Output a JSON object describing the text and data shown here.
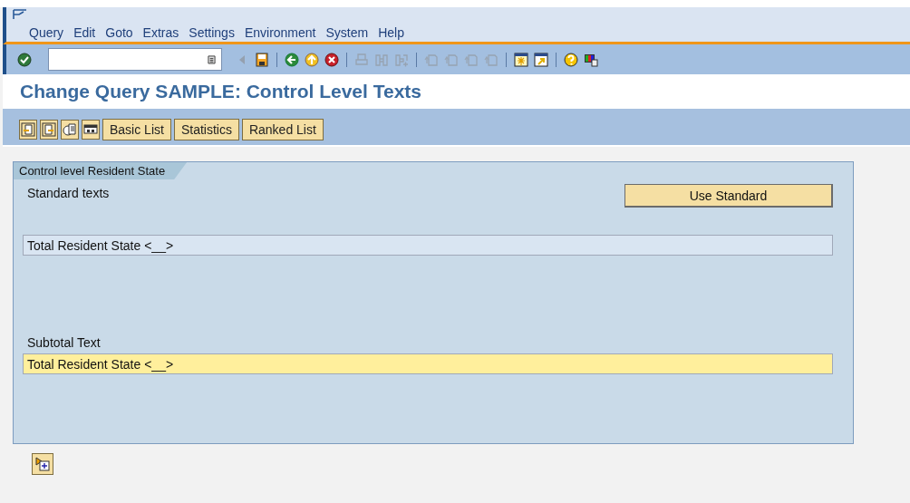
{
  "menu_bar": {
    "items": [
      "Query",
      "Edit",
      "Goto",
      "Extras",
      "Settings",
      "Environment",
      "System",
      "Help"
    ]
  },
  "system_toolbar": {
    "icons": [
      {
        "kind": "enter",
        "disabled": false
      },
      {
        "kind": "sep"
      },
      {
        "kind": "field"
      },
      {
        "kind": "triangle",
        "disabled": true
      },
      {
        "kind": "save",
        "disabled": false
      },
      {
        "kind": "sep"
      },
      {
        "kind": "back",
        "disabled": false
      },
      {
        "kind": "exit",
        "disabled": false
      },
      {
        "kind": "cancel",
        "disabled": false
      },
      {
        "kind": "sep"
      },
      {
        "kind": "print",
        "disabled": true
      },
      {
        "kind": "find",
        "disabled": true
      },
      {
        "kind": "findnext",
        "disabled": true
      },
      {
        "kind": "sep"
      },
      {
        "kind": "page",
        "disabled": true
      },
      {
        "kind": "page",
        "disabled": true
      },
      {
        "kind": "page",
        "disabled": true
      },
      {
        "kind": "page",
        "disabled": true
      },
      {
        "kind": "sep"
      },
      {
        "kind": "session",
        "disabled": false
      },
      {
        "kind": "shortcut",
        "disabled": false
      },
      {
        "kind": "sep"
      },
      {
        "kind": "help",
        "disabled": false
      },
      {
        "kind": "layout",
        "disabled": false
      }
    ]
  },
  "title": "Change Query SAMPLE: Control Level Texts",
  "app_toolbar": {
    "icon_buttons": [
      {
        "kind": "prev"
      },
      {
        "kind": "next"
      },
      {
        "kind": "copy"
      },
      {
        "kind": "screen"
      }
    ],
    "buttons": [
      "Basic List",
      "Statistics",
      "Ranked List"
    ]
  },
  "group": {
    "title": "Control level Resident State",
    "standard_label": "Standard texts",
    "use_standard_button": "Use Standard",
    "standard_field": {
      "value": "Total Resident State <__>",
      "editable": false
    },
    "subtotal_label": "Subtotal Text",
    "subtotal_field": {
      "value": "Total Resident State <__>",
      "editable": true
    }
  },
  "bottom_button": {
    "kind": "insert"
  }
}
